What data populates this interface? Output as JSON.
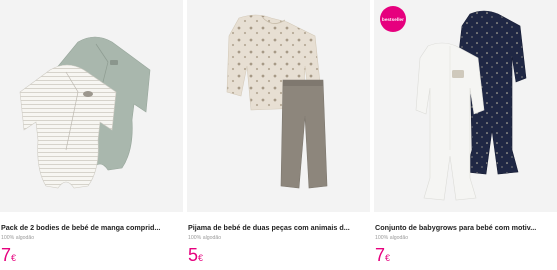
{
  "products": [
    {
      "title": "Pack de 2 bodies de bebé de manga comprid...",
      "material": "100% algodão",
      "price": "7",
      "currency": "€",
      "image": "two-bodysuits-image"
    },
    {
      "title": "Pijama de bebé de duas peças com animais d...",
      "material": "100% algodão",
      "price": "5",
      "currency": "€",
      "image": "pajama-set-image"
    },
    {
      "title": "Conjunto de babygrows para bebé com motiv...",
      "material": "100% algodão",
      "price": "7",
      "currency": "€",
      "image": "babygrows-set-image",
      "badge": "bestseller"
    }
  ],
  "colors": {
    "accent": "#e6007e",
    "image_bg": "#f3f3f3"
  }
}
